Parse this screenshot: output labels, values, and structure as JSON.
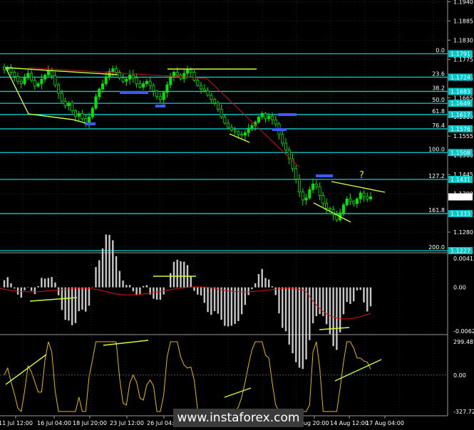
{
  "chart_data": [
    {
      "type": "candlestick",
      "title": "",
      "ylim": [
        1.1225,
        1.1945
      ],
      "price_ticks": [
        "1.1940",
        "1.1885",
        "1.1830",
        "1.1775",
        "1.1720",
        "1.1665",
        "1.1610",
        "1.1555",
        "1.1500",
        "1.1445",
        "1.1390",
        "1.1335",
        "1.1280",
        "1.1225"
      ],
      "current_price": "1.1381",
      "fib_levels": [
        {
          "ratio": "0.0",
          "price": "1.1791"
        },
        {
          "ratio": "23.6",
          "price": "1.1724"
        },
        {
          "ratio": "38.2",
          "price": "1.1683"
        },
        {
          "ratio": "50.0",
          "price": "1.1649"
        },
        {
          "ratio": "61.8",
          "price": "1.1617"
        },
        {
          "ratio": "76.4",
          "price": "1.1576"
        },
        {
          "ratio": "100.0",
          "price": "1.1508"
        },
        {
          "ratio": "127.2",
          "price": "1.1431"
        },
        {
          "ratio": "161.8",
          "price": "1.1333"
        },
        {
          "ratio": "200.0",
          "price": "1.1227"
        }
      ],
      "annotation": "?",
      "close_series": [
        1.1745,
        1.1752,
        1.1738,
        1.1726,
        1.1712,
        1.1705,
        1.1722,
        1.1735,
        1.1715,
        1.1698,
        1.1705,
        1.1718,
        1.173,
        1.1742,
        1.1728,
        1.1702,
        1.1678,
        1.1655,
        1.1642,
        1.165,
        1.1628,
        1.1612,
        1.162,
        1.1605,
        1.159,
        1.161,
        1.1635,
        1.1668,
        1.169,
        1.1705,
        1.1725,
        1.174,
        1.1748,
        1.1738,
        1.1722,
        1.1712,
        1.1718,
        1.173,
        1.1722,
        1.1705,
        1.1695,
        1.1705,
        1.1712,
        1.17,
        1.1684,
        1.1668,
        1.166,
        1.168,
        1.1702,
        1.1725,
        1.1738,
        1.173,
        1.172,
        1.1735,
        1.1745,
        1.1738,
        1.1715,
        1.17,
        1.169,
        1.1685,
        1.1672,
        1.166,
        1.165,
        1.1632,
        1.161,
        1.1592,
        1.158,
        1.1572,
        1.1568,
        1.156,
        1.1558,
        1.1565,
        1.1578,
        1.1585,
        1.1595,
        1.161,
        1.162,
        1.1605,
        1.1612,
        1.1602,
        1.159,
        1.156,
        1.1535,
        1.1515,
        1.149,
        1.1462,
        1.1432,
        1.1395,
        1.1372,
        1.1378,
        1.1402,
        1.1418,
        1.141,
        1.1385,
        1.1362,
        1.1348,
        1.1345,
        1.133,
        1.1315,
        1.1335,
        1.1358,
        1.1375,
        1.1368,
        1.1362,
        1.1375,
        1.1392,
        1.1382,
        1.1375,
        1.1381
      ],
      "x_ticks": [
        "11 Jul 12:00",
        "16 Jul 04:00",
        "18 Jul 20:00",
        "23 Jul 12:00",
        "26 Jul 04:00",
        "Aug 20:00",
        "14 Aug 12:00",
        "17 Aug 04:00"
      ]
    },
    {
      "type": "histogram",
      "title": "",
      "ylim": [
        -0.00621,
        0.00412
      ],
      "ticks": [
        "0.00412",
        "0.00",
        "-0.00621"
      ]
    },
    {
      "type": "line",
      "title": "",
      "ylim": [
        -327.725,
        299.482
      ],
      "ticks": [
        "299.482",
        "0.00",
        "-327.725"
      ]
    }
  ],
  "watermark": "www.instaforex.com",
  "colors": {
    "background": "#000000",
    "grid": "#2a2a2a",
    "fib_line": "#00d0d0",
    "fib_label_bg": "#00c8c8",
    "candles": "#00e600",
    "trendline": "#c8ff32",
    "highlight": "#3a5aff",
    "macd_bars": "#c8c8c8",
    "macd_signal": "#e01010",
    "cci_line": "#e6b800"
  }
}
